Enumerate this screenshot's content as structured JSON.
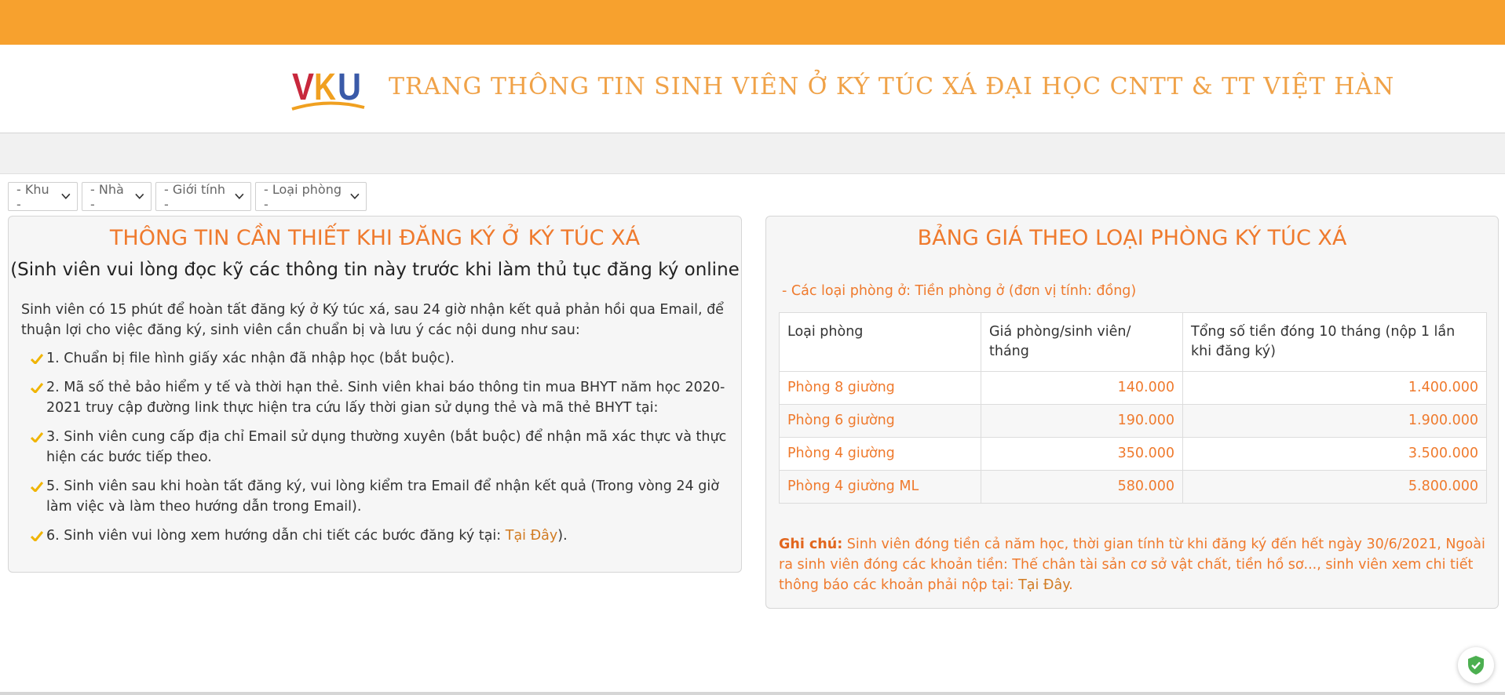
{
  "header": {
    "logo_text": "VKU",
    "title": "TRANG THÔNG TIN SINH VIÊN Ở KÝ TÚC XÁ ĐẠI HỌC CNTT & TT VIỆT HÀN"
  },
  "filters": [
    {
      "label": "- Khu -"
    },
    {
      "label": "- Nhà -"
    },
    {
      "label": "- Giới tính -"
    },
    {
      "label": "- Loại phòng -"
    }
  ],
  "info": {
    "title": "THÔNG TIN CẦN THIẾT KHI ĐĂNG KÝ Ở KÝ TÚC XÁ",
    "subtitle": "(Sinh viên vui lòng đọc kỹ các thông tin này trước khi làm thủ tục đăng ký online",
    "intro": "Sinh viên có 15 phút để hoàn tất đăng ký ở Ký túc xá, sau 24 giờ nhận kết quả phản hồi qua Email, để thuận lợi cho việc đăng ký, sinh viên cần chuẩn bị và lưu ý các nội dung như sau:",
    "items": [
      "1. Chuẩn bị file hình giấy xác nhận đã nhập học (bắt buộc).",
      "2. Mã số thẻ bảo hiểm y tế và thời hạn thẻ. Sinh viên khai báo thông tin mua BHYT năm học 2020-2021 truy cập đường link thực hiện tra cứu lấy thời gian sử dụng thẻ và mã thẻ BHYT tại:",
      "3. Sinh viên cung cấp địa chỉ Email sử dụng thường xuyên (bắt buộc) để nhận mã xác thực và thực hiện các bước tiếp theo.",
      "5. Sinh viên sau khi hoàn tất đăng ký, vui lòng kiểm tra Email để nhận kết quả (Trong vòng 24 giờ làm việc và làm theo hướng dẫn trong Email)."
    ],
    "item6_prefix": "6. Sinh viên vui lòng xem hướng dẫn chi tiết các bước đăng ký tại: ",
    "item6_link": "Tại Đây",
    "item6_suffix": ")."
  },
  "prices": {
    "title": "BẢNG GIÁ THEO LOẠI PHÒNG KÝ TÚC XÁ",
    "room_types_line": "- Các loại phòng ở: Tiền phòng ở (đơn vị tính: đồng)",
    "columns": [
      "Loại phòng",
      "Giá phòng/sinh viên/ tháng",
      "Tổng số tiền đóng 10 tháng (nộp 1 lần khi đăng ký)"
    ],
    "rows": [
      {
        "room": "Phòng 8 giường",
        "price": "140.000",
        "total": "1.400.000"
      },
      {
        "room": "Phòng 6 giường",
        "price": "190.000",
        "total": "1.900.000"
      },
      {
        "room": "Phòng 4 giường",
        "price": "350.000",
        "total": "3.500.000"
      },
      {
        "room": "Phòng 4 giường ML",
        "price": "580.000",
        "total": "5.800.000"
      }
    ],
    "note_label": "Ghi chú:",
    "note_text": " Sinh viên đóng tiền cả năm học, thời gian tính từ khi đăng ký đến hết ngày 30/6/2021, Ngoài ra sinh viên đóng các khoản tiền: Thế chân tài sản cơ sở vật chất, tiền hồ sơ..., sinh viên xem chi tiết thông báo các khoản phải nộp tại: ",
    "note_link": "Tại Đây",
    "note_end": "."
  },
  "colors": {
    "topbar": "#f7a12e",
    "accent": "#ef7a2d",
    "check": "#f0b400",
    "shield": "#4caf50"
  }
}
